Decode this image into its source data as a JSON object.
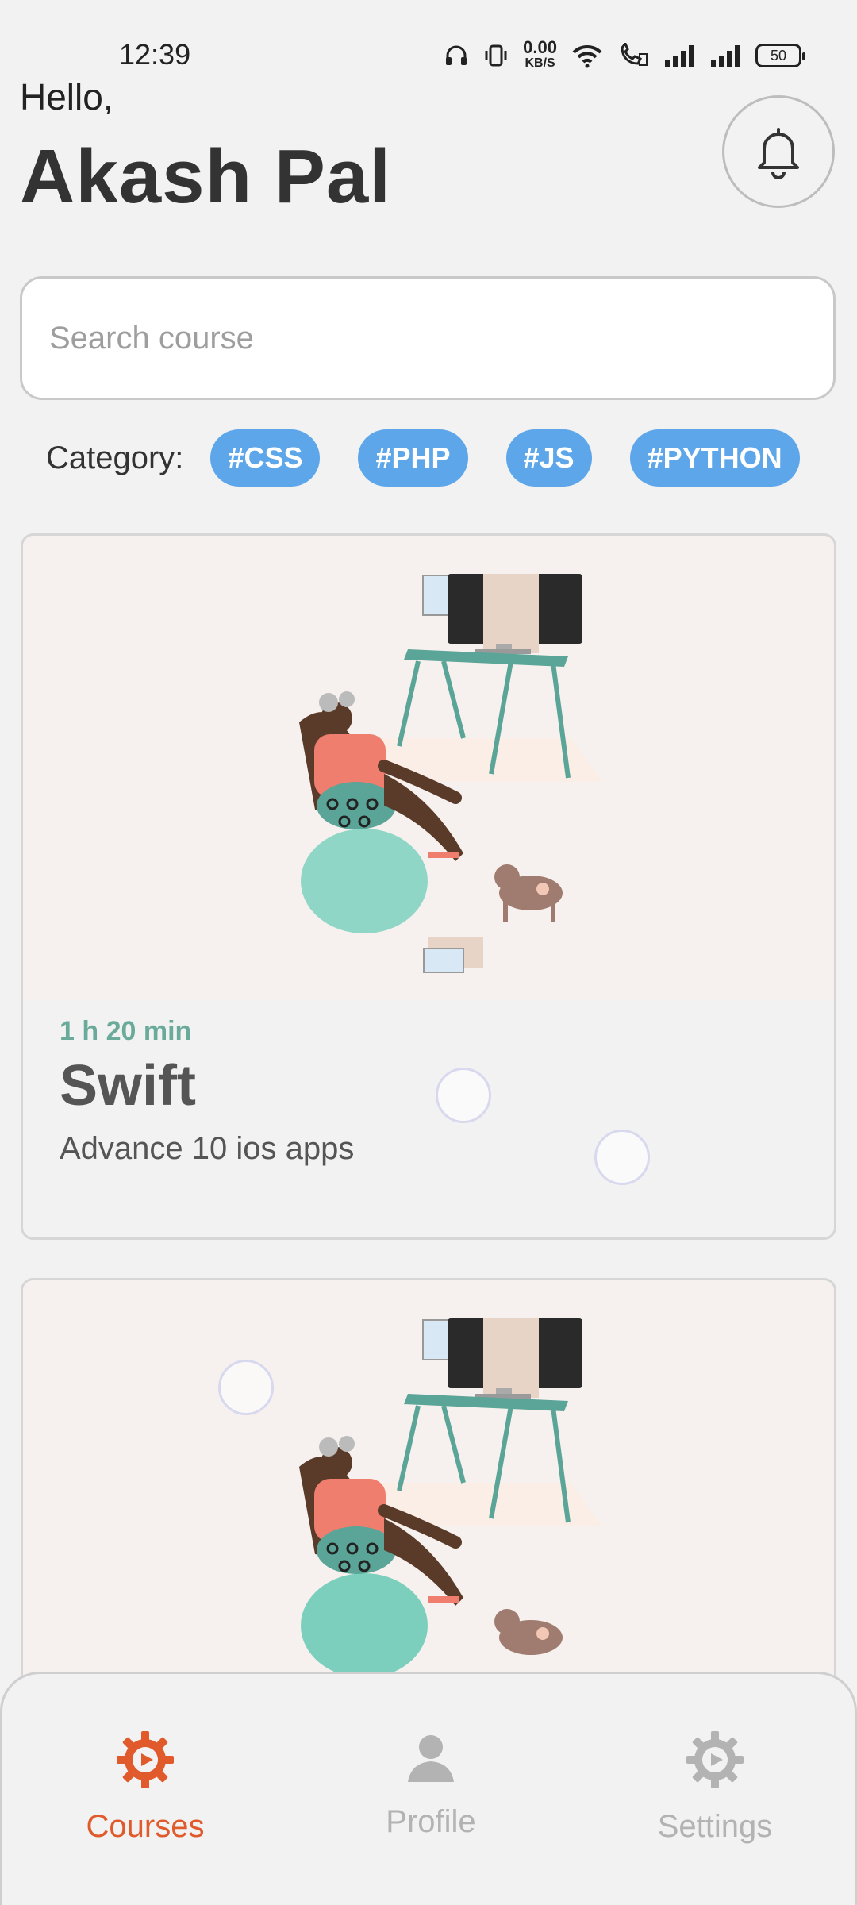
{
  "status_bar": {
    "time": "12:39",
    "net_speed": "0.00",
    "net_unit": "KB/S",
    "battery": "50"
  },
  "header": {
    "greeting": "Hello,",
    "name": "Akash Pal"
  },
  "search": {
    "placeholder": "Search course"
  },
  "category": {
    "label": "Category:",
    "chips": [
      "#CSS",
      "#PHP",
      "#JS",
      "#PYTHON"
    ]
  },
  "courses": [
    {
      "duration": "1 h 20 min",
      "title": "Swift",
      "subtitle": "Advance 10 ios apps"
    }
  ],
  "bottom_nav": {
    "items": [
      {
        "label": "Courses",
        "icon": "gear-play-icon",
        "active": true
      },
      {
        "label": "Profile",
        "icon": "person-icon",
        "active": false
      },
      {
        "label": "Settings",
        "icon": "gear-play-icon",
        "active": false
      }
    ]
  },
  "colors": {
    "accent": "#e05a2b",
    "chip": "#5ea6ea",
    "inactive": "#b3b3b3",
    "duration": "#6aaa9a"
  }
}
